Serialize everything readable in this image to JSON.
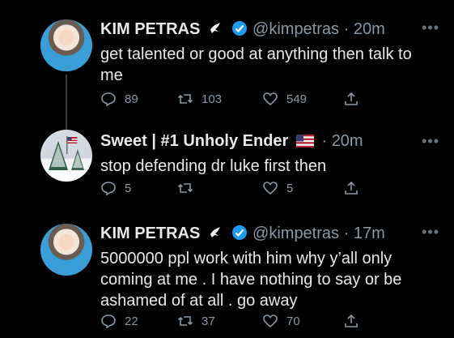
{
  "tweets": [
    {
      "name": "KIM PETRAS",
      "handle": "@kimpetras",
      "time": "20m",
      "text": "get talented or good at anything then talk to me",
      "replies": "89",
      "retweets": "103",
      "likes": "549"
    },
    {
      "name": "Sweet | #1 Unholy Ender",
      "handle": "",
      "time": "20m",
      "text": "stop defending dr luke first then",
      "replies": "5",
      "retweets": "",
      "likes": "5"
    },
    {
      "name": "KIM PETRAS",
      "handle": "@kimpetras",
      "time": "17m",
      "text": "5000000 ppl work with him why y’all only coming at me . I have nothing to say or be ashamed of at all . go away",
      "replies": "22",
      "retweets": "37",
      "likes": "70"
    }
  ],
  "ui": {
    "dot": "·",
    "more": "•••"
  },
  "icons": {
    "dove": "dove-icon",
    "verified": "verified-badge-icon",
    "flag": "us-flag-icon",
    "reply": "reply-icon",
    "retweet": "retweet-icon",
    "like": "heart-icon",
    "share": "share-icon"
  },
  "colors": {
    "verified": "#1d9bf0",
    "muted": "#8b98a5",
    "background": "#000000"
  }
}
